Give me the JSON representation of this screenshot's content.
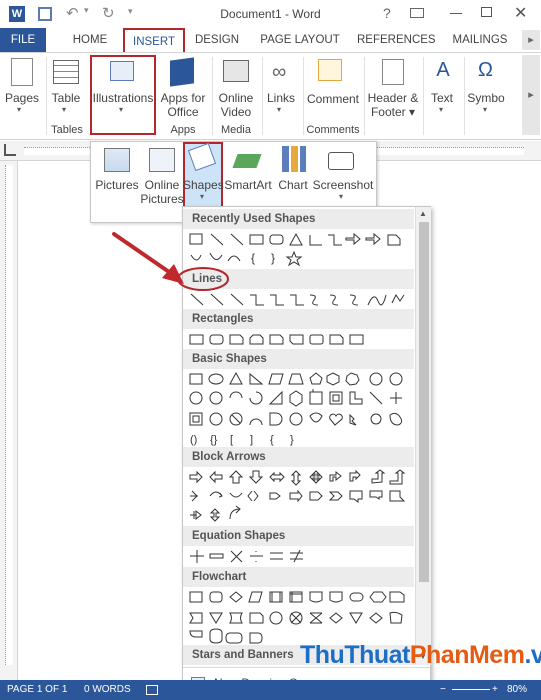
{
  "window": {
    "title": "Document1 - Word"
  },
  "tabs": [
    "FILE",
    "HOME",
    "INSERT",
    "DESIGN",
    "PAGE LAYOUT",
    "REFERENCES",
    "MAILINGS"
  ],
  "ribbon": {
    "pages": "Pages",
    "table": "Table",
    "tables_group": "Tables",
    "illustrations": "Illustrations",
    "apps_for": "Apps for",
    "office": "Office",
    "apps_group": "Apps",
    "online": "Online",
    "video": "Video",
    "media_group": "Media",
    "links": "Links",
    "comment": "Comment",
    "comments_group": "Comments",
    "header": "Header &",
    "footer": "Footer",
    "text": "Text",
    "symbols": "Symbo"
  },
  "illustrations_menu": {
    "pictures": "Pictures",
    "online": "Online",
    "pictures2": "Pictures",
    "shapes": "Shapes",
    "smartart": "SmartArt",
    "chart": "Chart",
    "screenshot": "Screenshot"
  },
  "shapes_gallery": {
    "categories": [
      "Recently Used Shapes",
      "Lines",
      "Rectangles",
      "Basic Shapes",
      "Block Arrows",
      "Equation Shapes",
      "Flowchart",
      "Stars and Banners"
    ],
    "new_canvas": "New Drawing Canvas"
  },
  "statusbar": {
    "page": "PAGE 1 OF 1",
    "words": "0 WORDS",
    "zoom": "80%"
  },
  "watermark": {
    "part1": "ThuThuat",
    "part2": "PhanMem",
    "part3": ".vn"
  },
  "colors": {
    "accent": "#2b579a",
    "highlight": "#b3262b",
    "arrow": "#c0282d"
  }
}
